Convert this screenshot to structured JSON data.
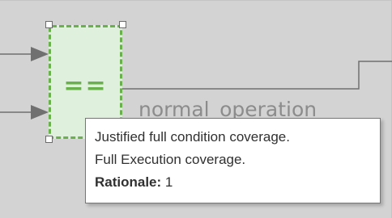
{
  "block": {
    "symbol": "=="
  },
  "signal": {
    "label": "normal_operation"
  },
  "tooltip": {
    "lines": [
      "Justified full condition coverage.",
      "Full Execution coverage."
    ],
    "rationale_label": "Rationale:",
    "rationale_value": "1"
  },
  "colors": {
    "canvas_background": "#d3d3d3",
    "block_fill": "#dff0dc",
    "block_border": "#6ab04c",
    "wire": "#707070"
  }
}
